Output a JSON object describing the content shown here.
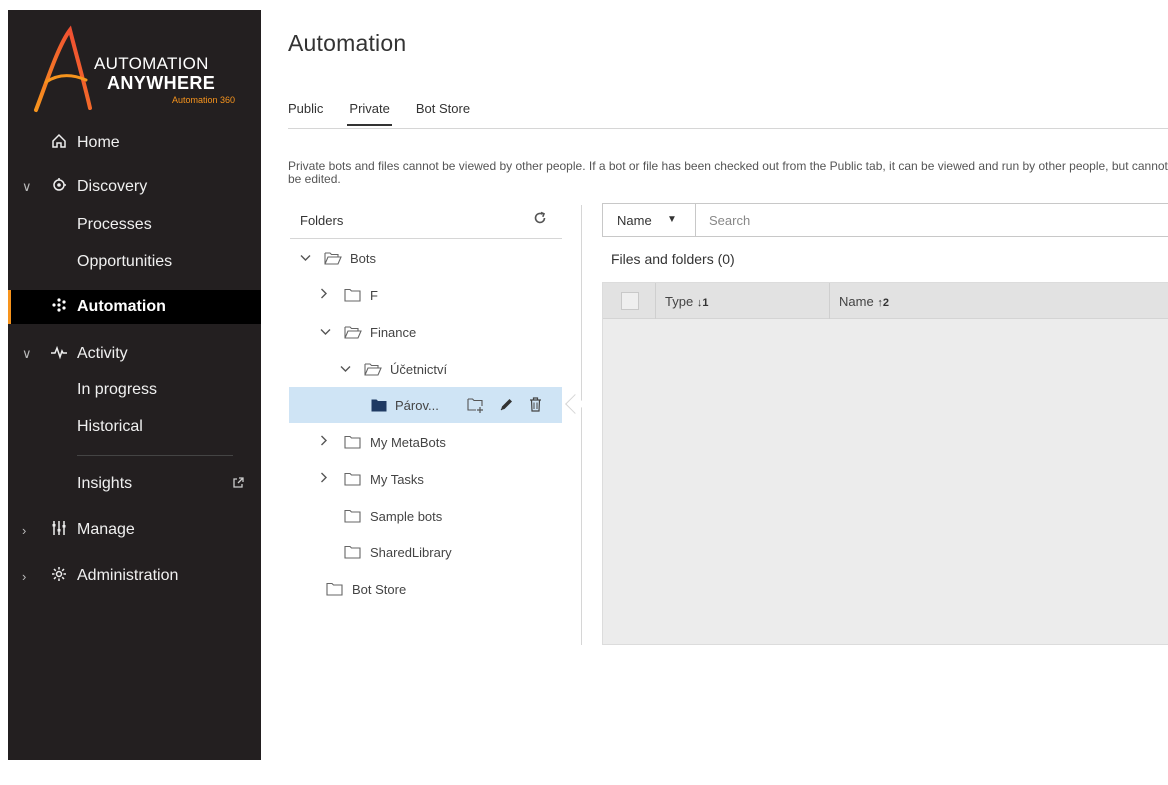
{
  "brand": {
    "line1": "AUTOMATION",
    "line2": "ANYWHERE",
    "line3": "Automation 360",
    "accent": "#f7941d"
  },
  "sidebar": {
    "items": [
      {
        "label": "Home",
        "icon": "home-icon"
      },
      {
        "label": "Discovery",
        "icon": "discovery-icon",
        "expanded": true
      },
      {
        "label": "Processes"
      },
      {
        "label": "Opportunities"
      },
      {
        "label": "Automation",
        "icon": "automation-icon",
        "active": true
      },
      {
        "label": "Activity",
        "icon": "activity-icon",
        "expanded": true
      },
      {
        "label": "In progress"
      },
      {
        "label": "Historical"
      },
      {
        "label": "Insights",
        "icon": "external-link-icon"
      },
      {
        "label": "Manage",
        "icon": "manage-icon",
        "expanded": false
      },
      {
        "label": "Administration",
        "icon": "administration-icon",
        "expanded": false
      }
    ]
  },
  "main": {
    "title": "Automation",
    "tabs": [
      {
        "label": "Public"
      },
      {
        "label": "Private",
        "active": true
      },
      {
        "label": "Bot Store"
      }
    ],
    "info": "Private bots and files cannot be viewed by other people. If a bot or file has been checked out from the Public tab, it can be viewed and run by other people, but cannot be edited."
  },
  "folders": {
    "header": "Folders",
    "tree": [
      {
        "label": "Bots",
        "expanded": true
      },
      {
        "label": "F",
        "expanded": false
      },
      {
        "label": "Finance",
        "expanded": true
      },
      {
        "label": "Účetnictví",
        "expanded": true
      },
      {
        "label": "Párov...",
        "selected": true
      },
      {
        "label": "My MetaBots",
        "expanded": false
      },
      {
        "label": "My Tasks",
        "expanded": false
      },
      {
        "label": "Sample bots"
      },
      {
        "label": "SharedLibrary"
      },
      {
        "label": "Bot Store"
      }
    ]
  },
  "files": {
    "search_field": "Name",
    "search_placeholder": "Search",
    "title": "Files and folders (0)",
    "columns": [
      {
        "label": "Type",
        "sort": "↓1"
      },
      {
        "label": "Name",
        "sort": "↑2"
      }
    ]
  }
}
